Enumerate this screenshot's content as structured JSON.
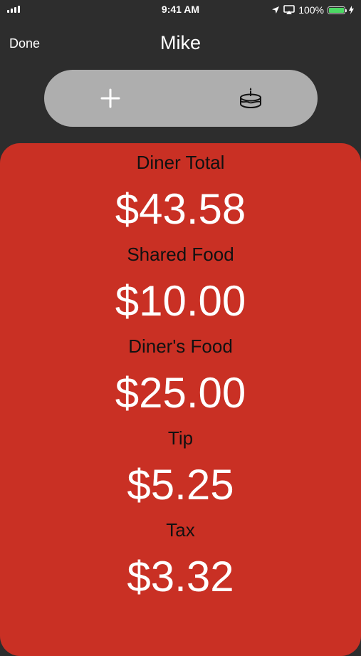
{
  "status_bar": {
    "time": "9:41 AM",
    "battery_percent": "100%",
    "battery_level": 1.0
  },
  "nav": {
    "done_label": "Done",
    "title": "Mike"
  },
  "segment": {
    "add_icon": "plus-icon",
    "cake_icon": "cake-icon"
  },
  "breakdown": [
    {
      "label": "Diner Total",
      "value": "$43.58"
    },
    {
      "label": "Shared Food",
      "value": "$10.00"
    },
    {
      "label": "Diner's Food",
      "value": "$25.00"
    },
    {
      "label": "Tip",
      "value": "$5.25"
    },
    {
      "label": "Tax",
      "value": "$3.32"
    }
  ],
  "colors": {
    "background": "#2d2d2d",
    "card": "#c93024",
    "segment": "#aeaeae",
    "battery": "#4cd964"
  }
}
